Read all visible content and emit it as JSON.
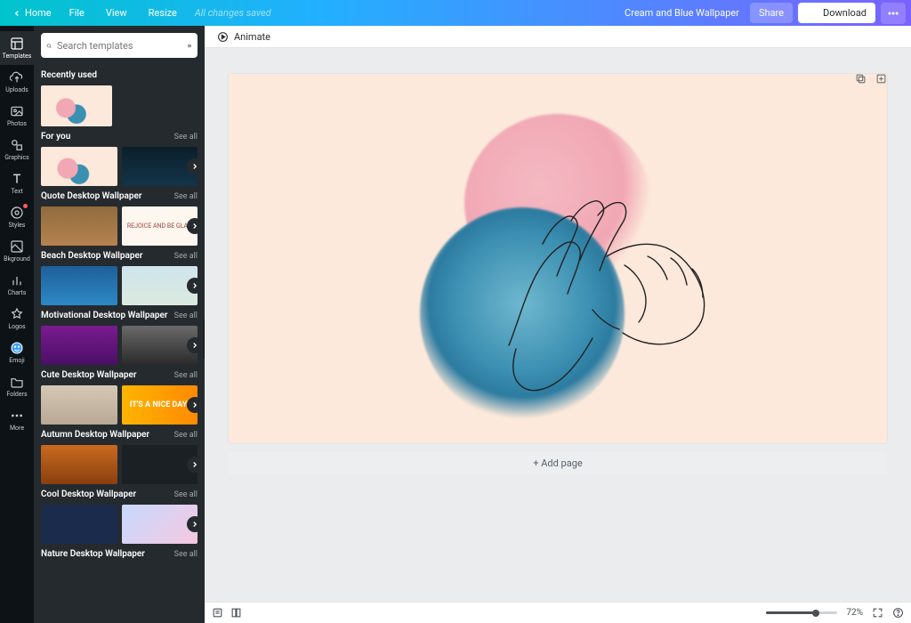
{
  "topbar": {
    "home": "Home",
    "file": "File",
    "view": "View",
    "resize": "Resize",
    "saved": "All changes saved",
    "doc_title": "Cream and Blue Wallpaper",
    "share": "Share",
    "download": "Download"
  },
  "rail": {
    "templates": "Templates",
    "uploads": "Uploads",
    "photos": "Photos",
    "graphics": "Graphics",
    "text": "Text",
    "styles": "Styles",
    "bkground": "Bkground",
    "charts": "Charts",
    "logos": "Logos",
    "emoji": "Emoji",
    "folders": "Folders",
    "more": "More"
  },
  "side": {
    "search_placeholder": "Search templates",
    "see_all": "See all",
    "sections": {
      "recently_used": "Recently used",
      "for_you": "For you",
      "quote": "Quote Desktop Wallpaper",
      "beach": "Beach Desktop Wallpaper",
      "motivational": "Motivational Desktop Wallpaper",
      "cute": "Cute Desktop Wallpaper",
      "autumn": "Autumn Desktop Wallpaper",
      "cool": "Cool Desktop Wallpaper",
      "nature": "Nature Desktop Wallpaper"
    },
    "thumbs": {
      "rejoice": "REJOICE AND BE GLAD",
      "nice_day": "IT'S A NICE DAY!"
    }
  },
  "editor": {
    "animate": "Animate",
    "add_page": "+ Add page"
  },
  "statusbar": {
    "zoom": "72%"
  },
  "colors": {
    "canvas_bg": "#fce9db",
    "blob_pink": "#f1a7b4",
    "blob_blue": "#3b8fb1"
  }
}
